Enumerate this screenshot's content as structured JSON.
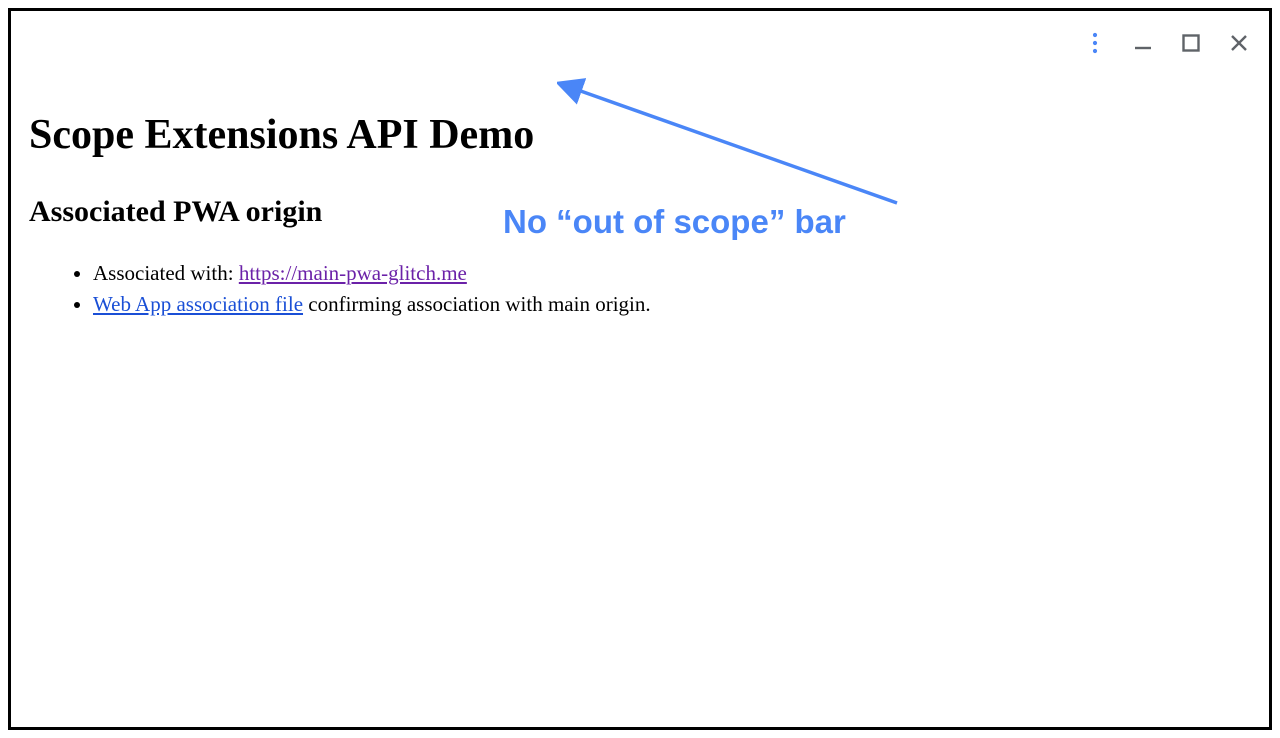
{
  "titlebar": {
    "icons": {
      "menu": "more-vert-icon",
      "minimize": "minimize-icon",
      "maximize": "maximize-icon",
      "close": "close-icon"
    }
  },
  "page": {
    "title": "Scope Extensions API Demo",
    "subtitle": "Associated PWA origin",
    "list": {
      "item1_prefix": "Associated with: ",
      "item1_link_text": "https://main-pwa-glitch.me",
      "item2_link_text": "Web App association file",
      "item2_suffix": " confirming association with main origin."
    }
  },
  "annotation": {
    "text": "No “out of scope” bar",
    "color": "#4a86f7"
  }
}
